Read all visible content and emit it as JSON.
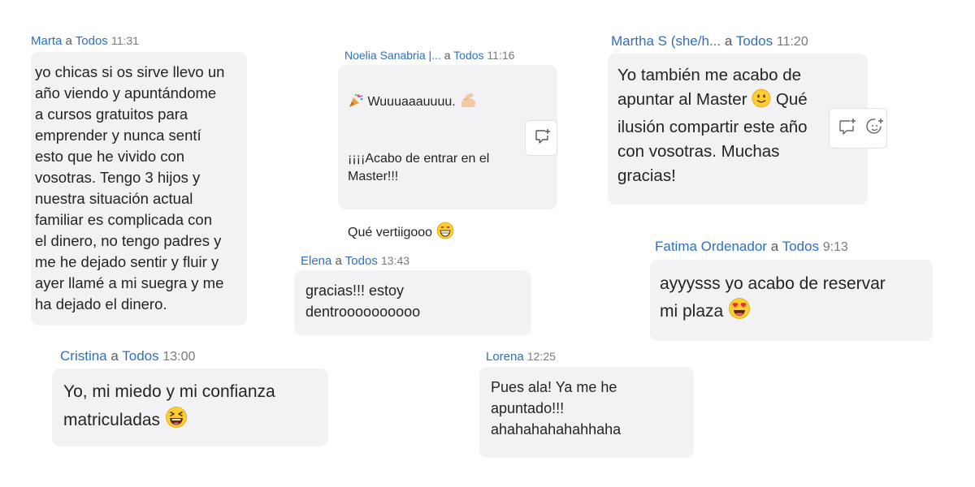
{
  "messages": [
    {
      "name": "Marta",
      "a": "a",
      "to": "Todos",
      "time": "11:31",
      "text": "yo chicas si os sirve llevo un\naño viendo y apuntándome\na cursos gratuitos para\nemprender y nunca sentí\nesto que he vivido con\nvosotras.  Tengo 3 hijos y\nnuestra situación actual\nfamiliar es complicada con\nel dinero, no tengo padres y\nme he dejado sentir y fluir y\nayer llamé a mi suegra y me\nha dejado el dinero."
    },
    {
      "name": "Noelia Sanabria |...",
      "a": "a",
      "to": "Todos",
      "time": "11:16",
      "line1": "Wuuuaaauuuu.",
      "line2": "¡¡¡¡Acabo de entrar en el\nMaster!!!",
      "line3": "Qué vertiigooo",
      "emojis": [
        "party-popper",
        "flexed-biceps",
        "grinning-face"
      ]
    },
    {
      "name": "Martha S (she/h...",
      "a": "a",
      "to": "Todos",
      "time": "11:20",
      "part1": "Yo también me acabo de\napuntar al Master ",
      "part2": " Qué\nilusión compartir este año\ncon vosotras. Muchas\ngracias!",
      "emoji": "smiling-face"
    },
    {
      "name": "Elena",
      "a": "a",
      "to": "Todos",
      "time": "13:43",
      "text": "gracias!!! estoy\ndentroooooooooo"
    },
    {
      "name": "Fatima Ordenador",
      "a": "a",
      "to": "Todos",
      "time": "9:13",
      "text": "ayyysss yo acabo de reservar\nmi plaza ",
      "emoji": "heart-eyes-face"
    },
    {
      "name": "Cristina",
      "a": "a",
      "to": "Todos",
      "time": "13:00",
      "text": "Yo, mi miedo y mi confianza\nmatriculadas ",
      "emoji": "laughing-face"
    },
    {
      "name": "Lorena",
      "time": "12:25",
      "text": "Pues ala! Ya me he\napuntado!!!\nahahahahahahhaha"
    }
  ],
  "icons": {
    "reply": "reply-icon",
    "react": "react-icon"
  },
  "colors": {
    "name": "#2f6fc4",
    "bubble": "#f2f2f4",
    "time": "#7a7a7a"
  }
}
